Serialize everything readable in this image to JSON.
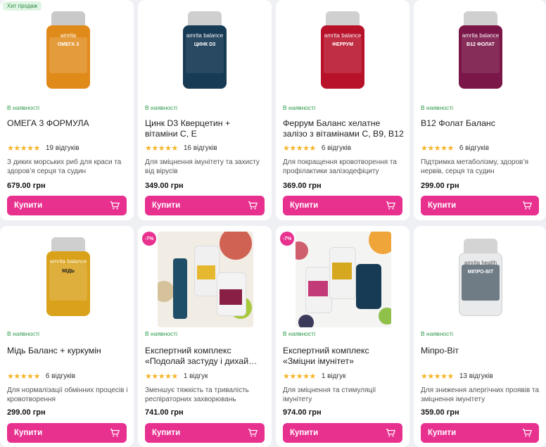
{
  "colors": {
    "accent": "#e8308f",
    "in_stock": "#2e9a4a",
    "stars": "#f5b427"
  },
  "products": [
    {
      "badge": "Хит продаж",
      "stock": "В наявності",
      "title": "ОМЕГА 3 ФОРМУЛА",
      "title2": "",
      "stars": "★★★★★",
      "reviews": "19 відгуків",
      "desc": "З диких морських риб для краси та здоров’я серця та судин",
      "price": "679.00 грн",
      "buy": "Купити",
      "jar": {
        "brand": "amrita",
        "label": "ОМЕГА 3",
        "color": "#e08a1a"
      }
    },
    {
      "badge": "",
      "stock": "В наявності",
      "title": "Цинк D3 Кверцетин +",
      "title2": "вітаміни С, Е",
      "stars": "★★★★★",
      "reviews": "16 відгуків",
      "desc": "Для зміцнення імунітету та захисту від вірусів",
      "price": "349.00 грн",
      "buy": "Купити",
      "jar": {
        "brand": "amrita balance",
        "label": "ЦИНК D3",
        "color": "#173a55"
      }
    },
    {
      "badge": "",
      "stock": "В наявності",
      "title": "Феррум Баланс хелатне",
      "title2": "залізо з вітамінами С, В9, В12",
      "stars": "★★★★★",
      "reviews": "6 відгуків",
      "desc": "Для покращення кровотворення та профілактики залізодефіциту",
      "price": "369.00 грн",
      "buy": "Купити",
      "jar": {
        "brand": "amrita balance",
        "label": "ФЕРРУМ",
        "color": "#b8122b"
      }
    },
    {
      "badge": "",
      "stock": "В наявності",
      "title": "В12 Фолат Баланс",
      "title2": "",
      "stars": "★★★★★",
      "reviews": "6 відгуків",
      "desc": "Підтримка метаболізму, здоров’я нервів, серця та судин",
      "price": "299.00 грн",
      "buy": "Купити",
      "jar": {
        "brand": "amrita balance",
        "label": "B12 ФОЛАТ",
        "color": "#7a1648"
      }
    },
    {
      "badge": "",
      "stock": "В наявності",
      "title": "Мідь Баланс + куркумін",
      "title2": "",
      "stars": "★★★★★",
      "reviews": "6 відгуків",
      "desc": "Для нормалізації обмінних процесів і кровотворення",
      "price": "299.00 грн",
      "buy": "Купити",
      "jar": {
        "brand": "amrita balance",
        "label": "МІДЬ",
        "color": "#d9a21a"
      }
    },
    {
      "badge": "-7%",
      "stock": "В наявності",
      "title": "Експертний комплекс",
      "title2": "«Подолай застуду і дихай…",
      "stars": "★★★★★",
      "reviews": "1 відгук",
      "desc": "Зменшує тяжкість та тривалість респіраторних захворювань",
      "price": "741.00 грн",
      "buy": "Купити",
      "photo": "cold"
    },
    {
      "badge": "-7%",
      "stock": "В наявності",
      "title": "Експертний комплекс",
      "title2": "«Зміцни імунітет»",
      "stars": "★★★★★",
      "reviews": "1 відгук",
      "desc": "Для зміцнення та стимуляції імунітету",
      "price": "974.00 грн",
      "buy": "Купити",
      "photo": "immune"
    },
    {
      "badge": "",
      "stock": "В наявності",
      "title": "Мiпро-Віт",
      "title2": "",
      "stars": "★★★★★",
      "reviews": "13 відгуків",
      "desc": "Для зниження алергічних проявів та зміцнення імунітету",
      "price": "359.00 грн",
      "buy": "Купити",
      "jar": {
        "brand": "amrita health",
        "label": "МІПРО-ВІТ",
        "color": "#6f7c86"
      }
    }
  ]
}
